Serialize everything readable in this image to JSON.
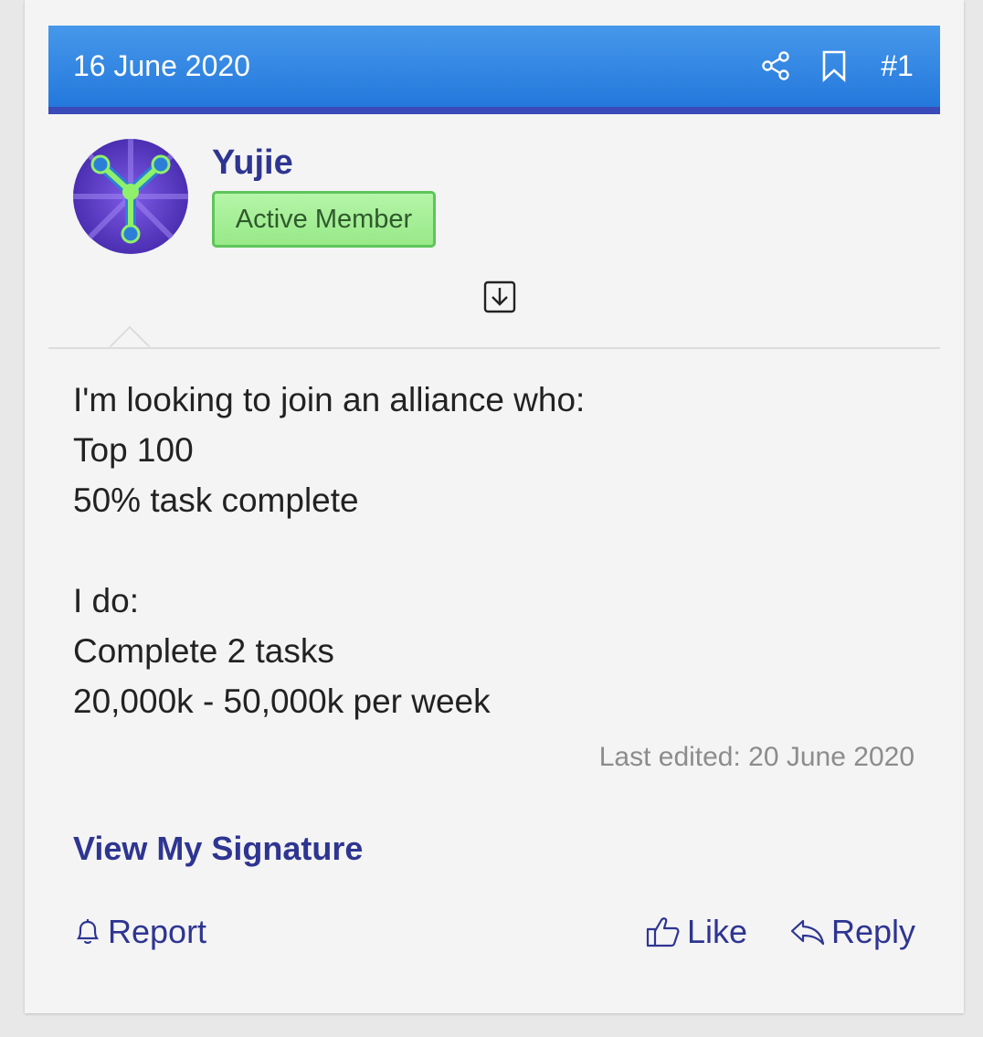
{
  "post": {
    "date": "16 June 2020",
    "number": "#1",
    "icons": {
      "share": "share-icon",
      "bookmark": "bookmark-icon",
      "expand": "expand-down-icon"
    }
  },
  "user": {
    "name": "Yujie",
    "title": "Active Member"
  },
  "content": {
    "lines": [
      "I'm looking to join an alliance who:",
      "Top 100",
      "50% task complete",
      "",
      "I do:",
      "Complete 2 tasks",
      "20,000k - 50,000k per week"
    ],
    "last_edited": "Last edited: 20 June 2020"
  },
  "signature_link": "View My Signature",
  "actions": {
    "report": "Report",
    "like": "Like",
    "reply": "Reply"
  },
  "colors": {
    "header_top": "#4698ea",
    "header_bottom": "#2478dc",
    "link": "#2e3591",
    "badge_bg": "#a8f09a",
    "badge_border": "#5ec55a"
  }
}
